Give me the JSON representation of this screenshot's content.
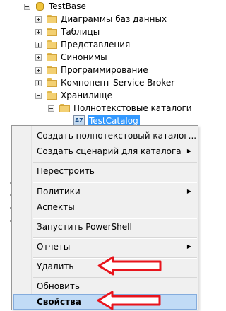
{
  "tree": {
    "root": "TestBase",
    "items": [
      "Диаграммы баз данных",
      "Таблицы",
      "Представления",
      "Синонимы",
      "Программирование",
      "Компонент Service Broker",
      "Хранилище"
    ],
    "storage_child": "Полнотекстовые каталоги",
    "selected_catalog": "TestCatalog",
    "catalog_icon_text": "AZ"
  },
  "menu": {
    "create_catalog": "Создать полнотекстовый каталог...",
    "script_catalog": "Создать сценарий для каталога",
    "rebuild": "Перестроить",
    "policies": "Политики",
    "facets": "Аспекты",
    "powershell": "Запустить PowerShell",
    "reports": "Отчеты",
    "delete": "Удалить",
    "refresh": "Обновить",
    "properties": "Свойства",
    "submenu_arrow": "▶"
  },
  "colors": {
    "selection": "#3399ff",
    "highlight": "#c1dbf6",
    "annotation_arrow": "#e8141c"
  }
}
